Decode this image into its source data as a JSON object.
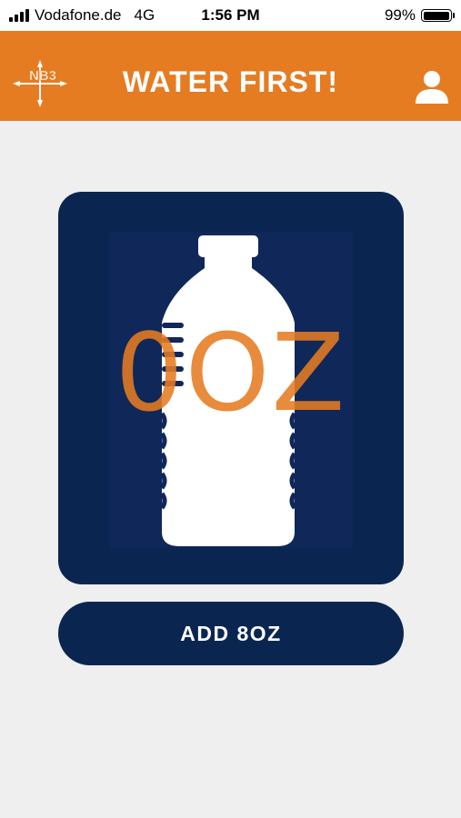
{
  "status_bar": {
    "carrier": "Vodafone.de",
    "network": "4G",
    "time": "1:56 PM",
    "battery_percent": "99%",
    "battery_level": 0.99
  },
  "header": {
    "title": "WATER FIRST!",
    "logo_text": "NB3",
    "logo_icon": "compass-logo-icon",
    "profile_icon": "user-icon"
  },
  "tracker": {
    "amount": "0OZ",
    "bottle_icon": "water-bottle-icon"
  },
  "actions": {
    "add_label": "ADD 8OZ"
  },
  "colors": {
    "accent": "#e57c22",
    "navy": "#0a2650",
    "background": "#efefef"
  }
}
